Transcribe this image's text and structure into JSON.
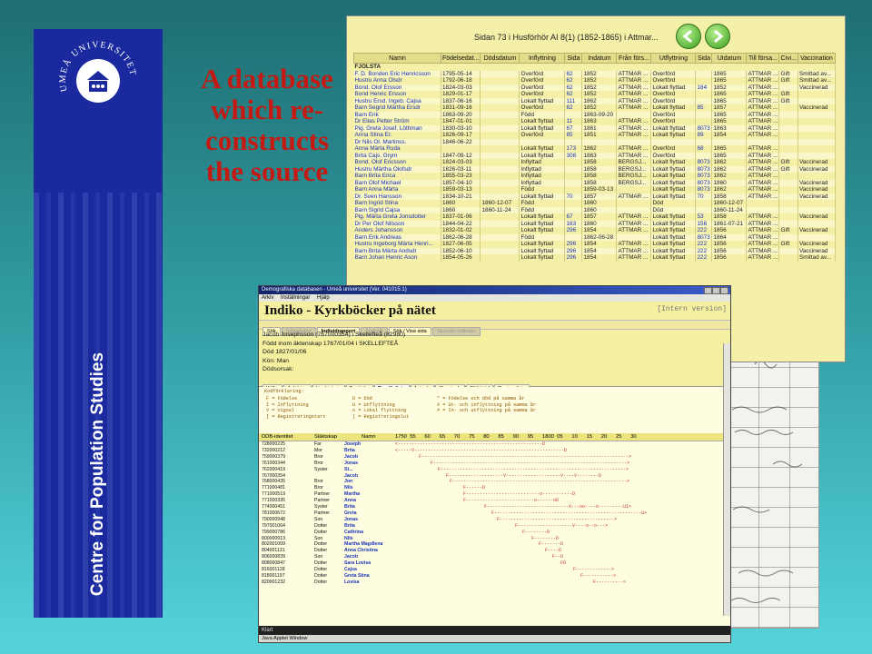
{
  "slide": {
    "banner_text": "Centre for Population Studies",
    "seal_text": "UMEÅ UNIVERSITET",
    "headline": [
      "A database",
      "which re-",
      "constructs",
      "the source"
    ],
    "colors": {
      "banner": "#1a2a9e",
      "headline": "#c41a14",
      "db_bg": "#f4f0a8"
    }
  },
  "db_window": {
    "title": "Sidan 73 i Husförhör AI 8(1) (1852-1865) i Attmar...",
    "nav_icons": [
      "arrow-back-icon",
      "arrow-forward-icon"
    ],
    "columns": [
      "Namn",
      "Födelsedat...",
      "Dödsdatum",
      "Inflyttning",
      "Sida",
      "Indatum",
      "Från förs...",
      "Utflyttning",
      "Sida",
      "Utdatum",
      "Till försa...",
      "Civi...",
      "Vaccination"
    ],
    "section_label": "FJÖLSTA",
    "rows": [
      [
        "F. D. Bonden Eric Henricsson",
        "1795-05-14",
        "",
        "Överförd",
        "62",
        "1852",
        "ATTMAR ...",
        "Överförd",
        "",
        "1865",
        "ATTMAR ...",
        "Gift",
        "Smittad av..."
      ],
      [
        "Hustru Anna Olsdr",
        "1792-06-18",
        "",
        "Överförd",
        "62",
        "1852",
        "ATTMAR ...",
        "Överförd",
        "",
        "1865",
        "ATTMAR ...",
        "Gift",
        "Smittad av..."
      ],
      [
        "Bond. Olof Ersson",
        "1824-03-03",
        "",
        "Överförd",
        "62",
        "1852",
        "ATTMAR ...",
        "Lokalt flyttad",
        "184",
        "1852",
        "ATTMAR ...",
        "",
        "Vaccinerad"
      ],
      [
        "Bond Henric Ersson",
        "1829-01-17",
        "",
        "Överförd",
        "62",
        "1852",
        "ATTMAR ...",
        "Överförd",
        "",
        "1865",
        "ATTMAR ...",
        "Gift",
        ""
      ],
      [
        "Hustru Ersd. Ingeb. Cajsa",
        "1837-06-16",
        "",
        "Lokalt flyttad",
        "111",
        "1862",
        "ATTMAR ...",
        "Överförd",
        "",
        "1865",
        "ATTMAR ...",
        "Gift",
        ""
      ],
      [
        "Barn Segrid Märtha Ersdr",
        "1831-09-16",
        "",
        "Överförd",
        "62",
        "1852",
        "ATTMAR ...",
        "Lokalt flyttad",
        "85",
        "1857",
        "ATTMAR ...",
        "",
        "Vaccinerad"
      ],
      [
        "Barn Erik",
        "1863-09-20",
        "",
        "Född",
        "",
        "1863-09-20",
        "",
        "Överförd",
        "",
        "1865",
        "ATTMAR ...",
        "",
        ""
      ],
      [
        "Dr Elias Petter Ström",
        "1847-01-01",
        "",
        "Lokalt flyttad",
        "11",
        "1863",
        "ATTMAR ...",
        "Överförd",
        "",
        "1865",
        "ATTMAR ...",
        "",
        ""
      ],
      [
        "Pig. Greta Josef. Löthman",
        "1830-03-10",
        "",
        "Lokalt flyttad",
        "67",
        "1861",
        "ATTMAR ...",
        "Lokalt flyttad",
        "8073",
        "1863",
        "ATTMAR ...",
        "",
        ""
      ],
      [
        "Anna Stina Er.",
        "1826-09-17",
        "",
        "Överförd",
        "85",
        "1851",
        "ATTMAR ...",
        "Lokalt flyttad",
        "89",
        "1854",
        "ATTMAR ...",
        "",
        ""
      ],
      [
        "Dr Nils Ol. Martinss.",
        "1846-06-22",
        "",
        "",
        "",
        "",
        "",
        "",
        "",
        "",
        "",
        "",
        ""
      ],
      [
        "Anna Märta Ruda",
        "",
        "",
        "Lokalt flyttad",
        "173",
        "1862",
        "ATTMAR ...",
        "Överförd",
        "68",
        "1865",
        "ATTMAR ...",
        "",
        ""
      ],
      [
        "Brita Cajs. Grym",
        "1847-09-12",
        "",
        "Lokalt flyttad",
        "308",
        "1863",
        "ATTMAR ...",
        "Överförd",
        "",
        "1865",
        "ATTMAR ...",
        "",
        ""
      ],
      [
        "Bond. Olof Ericsson",
        "1824-03-03",
        "",
        "Inflyttad",
        "",
        "1858",
        "BERGSJ...",
        "Lokalt flyttad",
        "8073",
        "1862",
        "ATTMAR ...",
        "Gift",
        "Vaccinerad"
      ],
      [
        "Hustru Märtha Olofsdr",
        "1826-03-11",
        "",
        "Inflyttad",
        "",
        "1858",
        "BERGSJ...",
        "Lokalt flyttad",
        "8073",
        "1862",
        "ATTMAR ...",
        "Gift",
        "Vaccinerad"
      ],
      [
        "Barn Brita Erica",
        "1855-03-23",
        "",
        "Inflyttad",
        "",
        "1858",
        "BERGSJ...",
        "Lokalt flyttad",
        "8073",
        "1862",
        "ATTMAR ...",
        "",
        ""
      ],
      [
        "Barn Olof Michael",
        "1857-04-10",
        "",
        "Inflyttad",
        "",
        "1858",
        "BERGSJ...",
        "Lokalt flyttad",
        "8073",
        "1860",
        "ATTMAR ...",
        "",
        "Vaccinerad"
      ],
      [
        "Barn Anna Märta",
        "1859-03-13",
        "",
        "Född",
        "",
        "1859-03-13",
        "",
        "Lokalt flyttad",
        "8073",
        "1862",
        "ATTMAR ...",
        "",
        "Vaccinerad"
      ],
      [
        "Dr. Sven Hansson",
        "1834-10-21",
        "",
        "Lokalt flyttad",
        "70",
        "1857",
        "ATTMAR ...",
        "Lokalt flyttad",
        "70",
        "1858",
        "ATTMAR ...",
        "",
        "Vaccinerad"
      ],
      [
        "Barn Ingrid Stina",
        "1860",
        "1860-12-07",
        "Född",
        "",
        "1860",
        "",
        "Död",
        "",
        "1860-12-07",
        "",
        "",
        ""
      ],
      [
        "Barn Sigrid Cajsa",
        "1860",
        "1860-11-24",
        "Född",
        "",
        "1860",
        "",
        "Död",
        "",
        "1860-11-24",
        "",
        "",
        ""
      ],
      [
        "Pig. Märta Greta Jonsdotter",
        "1837-01-06",
        "",
        "Lokalt flyttad",
        "67",
        "1857",
        "ATTMAR ...",
        "Lokalt flyttad",
        "53",
        "1858",
        "ATTMAR ...",
        "",
        "Vaccinerad"
      ],
      [
        "Dr Per Olof Nilsson",
        "1844-04-22",
        "",
        "Lokalt flyttad",
        "163",
        "1860",
        "ATTMAR ...",
        "Lokalt flyttad",
        "156",
        "1861-07-21",
        "ATTMAR ...",
        "",
        ""
      ],
      [
        "Anders Johansson",
        "1832-01-02",
        "",
        "Lokalt flyttad",
        "296",
        "1854",
        "ATTMAR ...",
        "Lokalt flyttad",
        "222",
        "1856",
        "ATTMAR ...",
        "Gift",
        "Vaccinerad"
      ],
      [
        "Barn Erik Andreas",
        "1862-06-28",
        "",
        "Född",
        "",
        "1862-06-28",
        "",
        "Lokalt flyttad",
        "8073",
        "1864",
        "ATTMAR ...",
        "",
        ""
      ],
      [
        "Hustru Ingeborg Märta Henri...",
        "1827-06-05",
        "",
        "Lokalt flyttad",
        "296",
        "1854",
        "ATTMAR ...",
        "Lokalt flyttad",
        "222",
        "1856",
        "ATTMAR ...",
        "Gift",
        "Vaccinerad"
      ],
      [
        "Barn Brita Märta Andsdr",
        "1852-06-10",
        "",
        "Lokalt flyttad",
        "296",
        "1854",
        "ATTMAR ...",
        "Lokalt flyttad",
        "222",
        "1856",
        "ATTMAR ...",
        "",
        "Vaccinerad"
      ],
      [
        "Barn Johan Henric Ason",
        "1854-05-26",
        "",
        "Lokalt flyttad",
        "296",
        "1854",
        "ATTMAR ...",
        "Lokalt flyttad",
        "222",
        "1856",
        "ATTMAR ...",
        "",
        "Smittad av..."
      ]
    ]
  },
  "app": {
    "window_title": "Demografiska databasen - Umeå universitet   (Ver. 041015:1)",
    "menu": [
      "Arkiv",
      "Inställningar",
      "Hjälp"
    ],
    "title": "Indiko - Kyrkböcker på nätet",
    "version_label": "[Intern version]",
    "nav_tabs": [
      "Sök",
      "Sökresultat",
      "Individrapport",
      "Statistik",
      "Sök / Visa sida",
      "Sparade individer"
    ],
    "person": [
      "Jacob Josephsson (767000354) i Skellefteå (82980)",
      "Född inom äktenskap 1767/01/04 i SKELLEFTEÅ",
      "Död 1827/01/06",
      "Kön: Man",
      "Dödsorsak:"
    ],
    "detail_tabs": [
      "Källor",
      "Anhöriga",
      "Livshistoria",
      "Bostäder",
      "Familjelinje",
      "Antavla",
      "Stamtavla",
      "Släktträd",
      "Regionslinje"
    ],
    "legend_heading": "Kodförklaring:",
    "legend_col1": [
      "F = Födelse",
      "I = Inflyttning",
      "V = Vigsel",
      "[ = Registreringstart"
    ],
    "legend_col2": [
      "D = Död",
      "U = Utflyttning",
      "o = Lokal flyttning",
      "] = Registreringslut"
    ],
    "legend_col3": [
      "* = Födelse och död på samma år",
      "X = Ut- och inflyttning på samma år",
      "# = In- och utflyttning på samma år"
    ],
    "family_head": {
      "id": "DDB-identitet",
      "relation": "Släktskap",
      "name": "Namn",
      "years": [
        "1750",
        "55",
        "60",
        "65",
        "70",
        "75",
        "80",
        "85",
        "90",
        "95",
        "1800",
        "05",
        "10",
        "15",
        "20",
        "25",
        "30"
      ]
    },
    "family_rows": [
      {
        "id": "728000225",
        "rel": "Far",
        "name": "Joseph",
        "line": "<-----------------------------------------------------D"
      },
      {
        "id": "732000212",
        "rel": "Mor",
        "name": "Brita",
        "line": "<-----V-------------------------------------------------------D"
      },
      {
        "id": "759000379",
        "rel": "Bror",
        "name": "Jacob",
        "line": "F---------------------------------------------------------------------------->"
      },
      {
        "id": "761000344",
        "rel": "Bror",
        "name": "Jonas",
        "line": "F----------------------------------------------------------------------->"
      },
      {
        "id": "762000419",
        "rel": "Syster",
        "name": "St...",
        "line": "F-------------------------------------------------------------------->"
      },
      {
        "id": "767000354",
        "rel": "",
        "name": "Jacob",
        "line": "F--------------------V--------------------V----V--------D"
      },
      {
        "id": "768000435",
        "rel": "Bror",
        "name": "Jon",
        "line": "F---------------------------------------------------------------->"
      },
      {
        "id": "771000481",
        "rel": "Bror",
        "name": "Nils",
        "line": "F------D"
      },
      {
        "id": "771000519",
        "rel": "Partner",
        "name": "Martha",
        "line": "F---------------------------o-----------D"
      },
      {
        "id": "771000335",
        "rel": "Partner",
        "name": "Anna",
        "line": "F-------------------------o------oD"
      },
      {
        "id": "774000451",
        "rel": "Syster",
        "name": "Brita",
        "line": "F------------------------------X---oo----o---------UI>"
      },
      {
        "id": "781000672",
        "rel": "Partner",
        "name": "Greta",
        "line": "F------------------------------------------------------U>"
      },
      {
        "id": "790000948",
        "rel": "Son",
        "name": "Jonas",
        "line": "F------------------------------------------>"
      },
      {
        "id": "797001064",
        "rel": "Dotter",
        "name": "Brita",
        "line": "F--------------------V----o--o--->"
      },
      {
        "id": "799000786",
        "rel": "Dotter",
        "name": "Cathrina",
        "line": "F--------D"
      },
      {
        "id": "800000913",
        "rel": "Son",
        "name": "Nils",
        "line": "F--------D"
      },
      {
        "id": "802001009",
        "rel": "Dotter",
        "name": "Martha Magdlena",
        "line": "F-------D"
      },
      {
        "id": "804001131",
        "rel": "Dotter",
        "name": "Anna Christina",
        "line": "F----D"
      },
      {
        "id": "806000839",
        "rel": "Son",
        "name": "Jacob",
        "line": "F--D"
      },
      {
        "id": "808000847",
        "rel": "Dotter",
        "name": "Sara Lovisa",
        "line": "FD"
      },
      {
        "id": "816001128",
        "rel": "Dotter",
        "name": "Cajsa",
        "line": "F------------->"
      },
      {
        "id": "818001197",
        "rel": "Dotter",
        "name": "Greta Stina",
        "line": "F----------->"
      },
      {
        "id": "820001232",
        "rel": "Dotter",
        "name": "Lovisa",
        "line": "F---------->"
      }
    ],
    "status": "Klart",
    "applet_label": "Java Applet Window"
  }
}
